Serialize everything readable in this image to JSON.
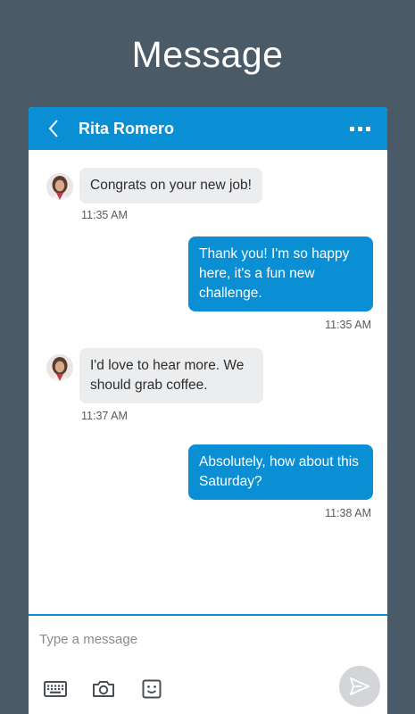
{
  "page": {
    "heading": "Message"
  },
  "chat": {
    "contact_name": "Rita Romero",
    "messages": [
      {
        "direction": "incoming",
        "text": "Congrats on your new job!",
        "time": "11:35 AM"
      },
      {
        "direction": "outgoing",
        "text": "Thank you! I'm so happy here, it's a fun new challenge.",
        "time": "11:35 AM"
      },
      {
        "direction": "incoming",
        "text": "I'd love to hear more. We should grab coffee.",
        "time": "11:37 AM"
      },
      {
        "direction": "outgoing",
        "text": "Absolutely, how about this Saturday?",
        "time": "11:38 AM"
      }
    ]
  },
  "composer": {
    "placeholder": "Type a message",
    "tools": [
      "keyboard-icon",
      "camera-icon",
      "emoji-icon"
    ],
    "send_icon": "send-icon"
  },
  "colors": {
    "background": "#4b5a67",
    "accent": "#0a8fd4",
    "incoming_bubble": "#ecedef",
    "send_button_disabled": "#d3d5d8"
  }
}
